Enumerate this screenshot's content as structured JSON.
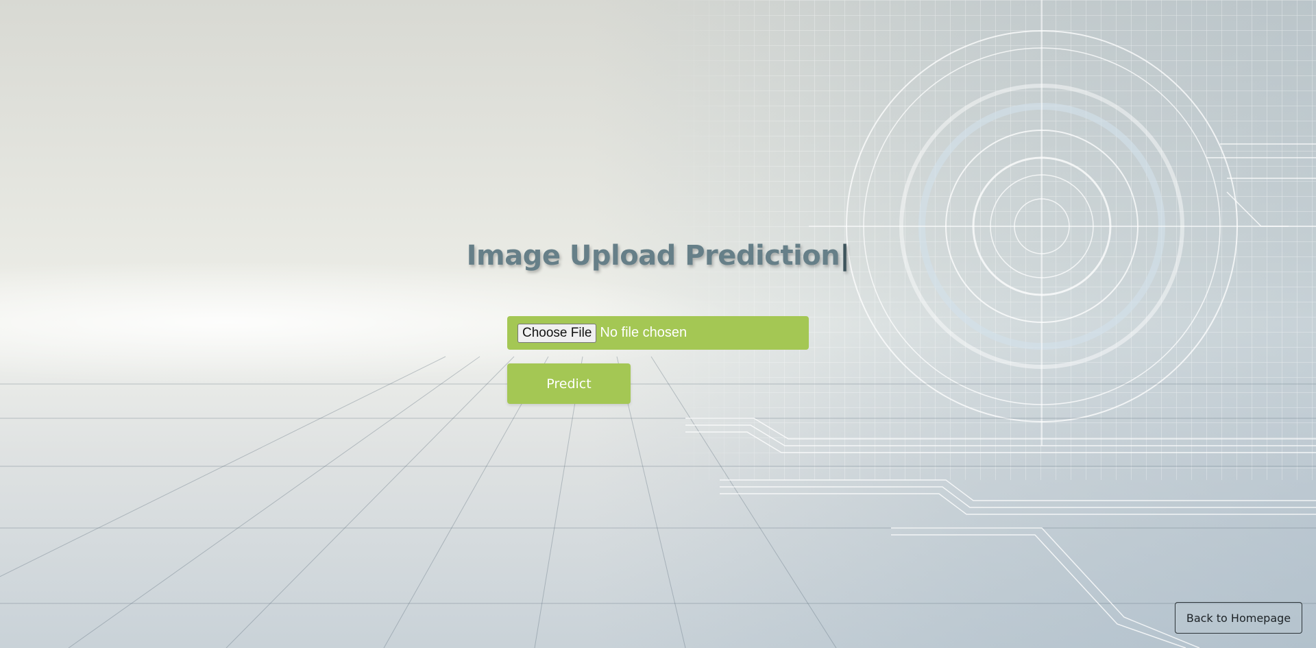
{
  "page": {
    "title": "Image Upload Prediction",
    "title_caret": "|"
  },
  "upload": {
    "choose_label": "Choose File",
    "status_text": "No file chosen"
  },
  "actions": {
    "predict_label": "Predict",
    "back_label": "Back to Homepage"
  },
  "colors": {
    "accent": "#a4c754",
    "title": "#667f88",
    "button_text": "#ffffff"
  },
  "icons": {
    "background": "circuit-board-background"
  }
}
